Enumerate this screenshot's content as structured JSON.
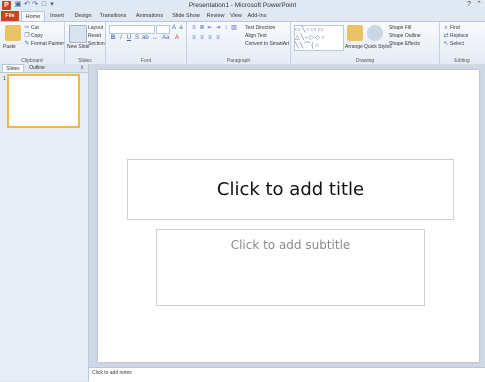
{
  "window": {
    "title": "Presentation1 - Microsoft PowerPoint",
    "app_icon": "P",
    "quick_access": [
      "save-icon",
      "undo-icon",
      "redo-icon",
      "new-icon",
      "customize-icon"
    ],
    "controls": {
      "help": "?",
      "minimize_ribbon": "⌃"
    }
  },
  "tabs": [
    {
      "label": "File"
    },
    {
      "label": "Home"
    },
    {
      "label": "Insert"
    },
    {
      "label": "Design"
    },
    {
      "label": "Transitions"
    },
    {
      "label": "Animations"
    },
    {
      "label": "Slide Show"
    },
    {
      "label": "Review"
    },
    {
      "label": "View"
    },
    {
      "label": "Add-Ins"
    }
  ],
  "ribbon": {
    "clipboard": {
      "label": "Clipboard",
      "paste": "Paste",
      "cut": "Cut",
      "copy": "Copy",
      "format_painter": "Format Painter"
    },
    "slides": {
      "label": "Slides",
      "new_slide": "New Slide",
      "layout": "Layout",
      "reset": "Reset",
      "section": "Section"
    },
    "font": {
      "label": "Font"
    },
    "paragraph": {
      "label": "Paragraph",
      "text_direction": "Text Direction",
      "align_text": "Align Text",
      "convert_smartart": "Convert to SmartArt"
    },
    "drawing": {
      "label": "Drawing",
      "arrange": "Arrange",
      "quick_styles": "Quick Styles",
      "shape_fill": "Shape Fill",
      "shape_outline": "Shape Outline",
      "shape_effects": "Shape Effects"
    },
    "editing": {
      "label": "Editing",
      "find": "Find",
      "replace": "Replace",
      "select": "Select"
    }
  },
  "panel": {
    "tabs": [
      "Slides",
      "Outline"
    ],
    "close": "x",
    "slide_number": "1"
  },
  "slide": {
    "title_placeholder": "Click to add title",
    "subtitle_placeholder": "Click to add subtitle"
  },
  "notes": {
    "placeholder": "Click to add notes"
  },
  "colors": {
    "file_tab": "#c4461f",
    "selected_thumb_border": "#f0b84a",
    "ribbon_bg": "#e4ebf4"
  }
}
